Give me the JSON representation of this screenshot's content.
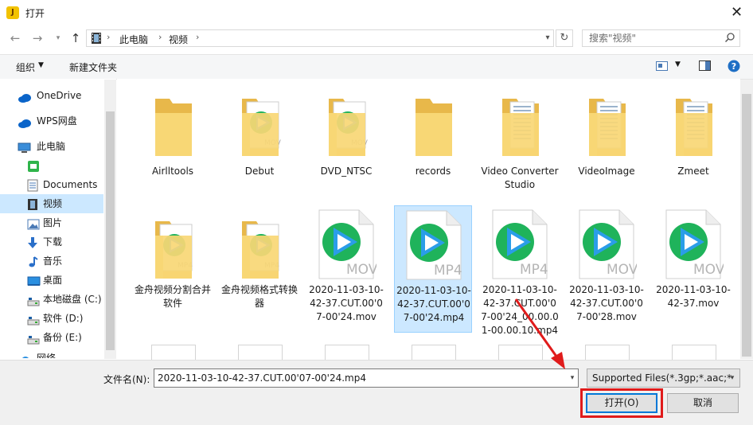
{
  "window": {
    "title": "打开",
    "app_icon_glyph": "J",
    "close_glyph": "✕"
  },
  "address": {
    "crumbs": [
      "此电脑",
      "视频"
    ],
    "search_placeholder": "搜索\"视频\""
  },
  "toolbar": {
    "organize": "组织",
    "new_folder": "新建文件夹"
  },
  "nav": {
    "items": [
      {
        "label": "OneDrive",
        "icon": "cloud-icon"
      },
      {
        "label": "WPS网盘",
        "icon": "cloud-icon"
      },
      {
        "label": "此电脑",
        "icon": "computer-icon"
      },
      {
        "label": "",
        "icon": "app-icon"
      },
      {
        "label": "Documents",
        "icon": "document-icon"
      },
      {
        "label": "视频",
        "icon": "video-icon",
        "selected": true
      },
      {
        "label": "图片",
        "icon": "picture-icon"
      },
      {
        "label": "下载",
        "icon": "download-icon"
      },
      {
        "label": "音乐",
        "icon": "music-icon"
      },
      {
        "label": "桌面",
        "icon": "desktop-icon"
      },
      {
        "label": "本地磁盘 (C:)",
        "icon": "drive-icon"
      },
      {
        "label": "软件 (D:)",
        "icon": "drive-icon"
      },
      {
        "label": "备份 (E:)",
        "icon": "drive-icon"
      },
      {
        "label": "网络",
        "icon": "network-icon"
      }
    ]
  },
  "files": [
    {
      "name": "Airlltools",
      "kind": "folder"
    },
    {
      "name": "Debut",
      "kind": "folder-video",
      "tag": "MOV"
    },
    {
      "name": "DVD_NTSC",
      "kind": "folder-video",
      "tag": "MOV"
    },
    {
      "name": "records",
      "kind": "folder"
    },
    {
      "name": "Video Converter Studio",
      "kind": "folder-doc"
    },
    {
      "name": "VideoImage",
      "kind": "folder-doc"
    },
    {
      "name": "Zmeet",
      "kind": "folder-doc"
    },
    {
      "name": "金舟视频分割合并软件",
      "kind": "folder-video",
      "tag": "MP4"
    },
    {
      "name": "金舟视频格式转换器",
      "kind": "folder-video",
      "tag": "MP4"
    },
    {
      "name": "2020-11-03-10-42-37.CUT.00'07-00'24.mov",
      "kind": "video",
      "tag": "MOV"
    },
    {
      "name": "2020-11-03-10-42-37.CUT.00'07-00'24.mp4",
      "kind": "video",
      "tag": "MP4",
      "selected": true
    },
    {
      "name": "2020-11-03-10-42-37.CUT.00'07-00'24_00.00.01-00.00.10.mp4",
      "kind": "video",
      "tag": "MP4"
    },
    {
      "name": "2020-11-03-10-42-37.CUT.00'07-00'28.mov",
      "kind": "video",
      "tag": "MOV"
    },
    {
      "name": "2020-11-03-10-42-37.mov",
      "kind": "video",
      "tag": "MOV"
    }
  ],
  "bottom": {
    "filename_label": "文件名(N):",
    "filename_value": "2020-11-03-10-42-37.CUT.00'07-00'24.mp4",
    "filter": "Supported Files(*.3gp;*.aac;*",
    "open": "打开(O)",
    "cancel": "取消"
  },
  "colors": {
    "accent": "#0078d7",
    "selection": "#cce8ff",
    "highlight": "#e01b1b",
    "folder": "#f8d775"
  }
}
